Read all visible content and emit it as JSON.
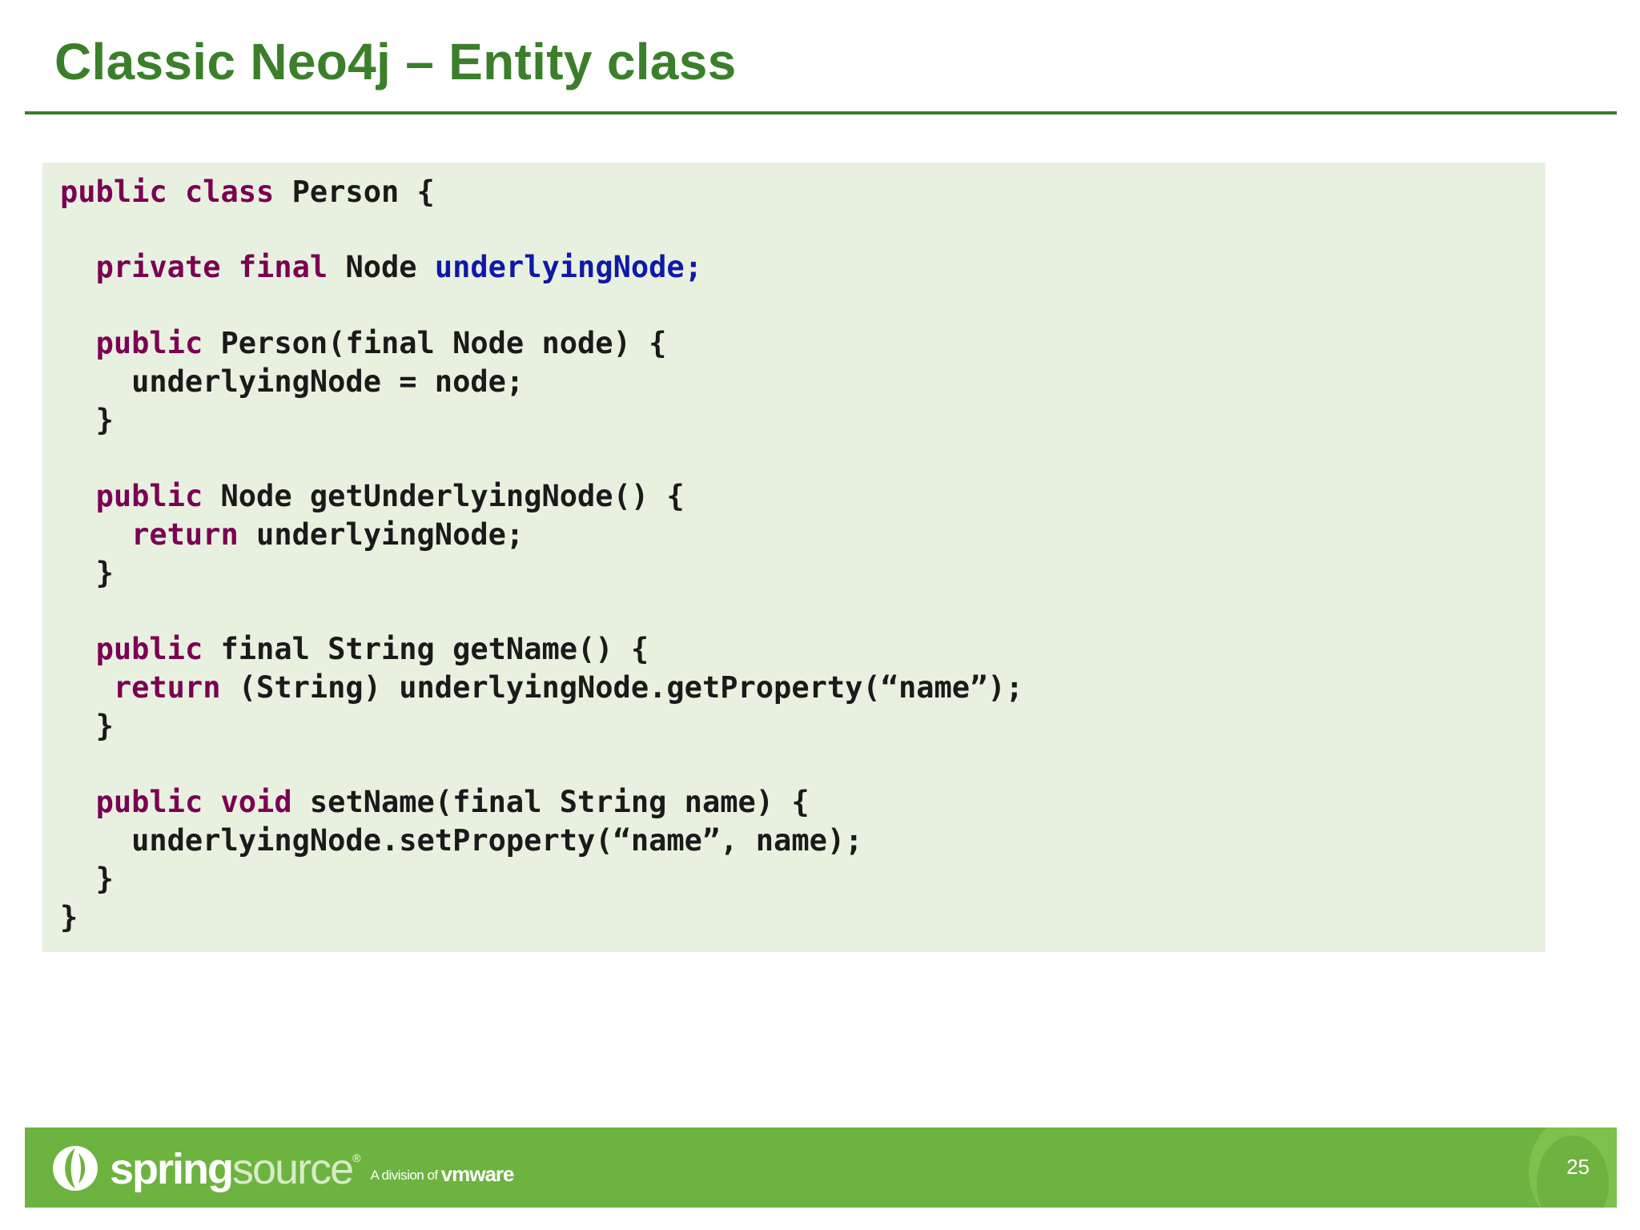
{
  "slide": {
    "title": "Classic Neo4j – Entity class",
    "page_number": "25"
  },
  "code": {
    "l1": {
      "kw1": "public",
      "kw2": "class",
      "rest": "Person {"
    },
    "l2": {
      "kw1": "private",
      "kw2": "final",
      "type": "Node",
      "field": "underlyingNode;"
    },
    "l3": {
      "kw": "public",
      "rest": "Person(final Node node) {"
    },
    "l4": {
      "text": "underlyingNode = node;"
    },
    "l5": {
      "text": "}"
    },
    "l6": {
      "kw": "public",
      "rest": "Node getUnderlyingNode() {"
    },
    "l7": {
      "kw": "return",
      "rest": "underlyingNode;"
    },
    "l8": {
      "text": "}"
    },
    "l9": {
      "kw": "public",
      "rest": "final String getName() {"
    },
    "l10": {
      "kw": "return",
      "rest": "(String) underlyingNode.getProperty(“name”);"
    },
    "l11": {
      "text": "}"
    },
    "l12": {
      "kw1": "public",
      "kw2": "void",
      "rest": "setName(final String name) {"
    },
    "l13": {
      "text": "underlyingNode.setProperty(“name”, name);"
    },
    "l14": {
      "text": "}"
    },
    "l15": {
      "text": "}"
    }
  },
  "footer": {
    "brand_spring": "spring",
    "brand_source": "source",
    "trademark": "®",
    "division_text": "A division of",
    "vmware": "vmware",
    "logo_icon": "springsource-leaf-icon",
    "background_color": "#6db33f"
  },
  "colors": {
    "title": "#3b7f2a",
    "code_background": "#e8f1e0",
    "keyword": "#7b0052",
    "field": "#0f19a8"
  }
}
